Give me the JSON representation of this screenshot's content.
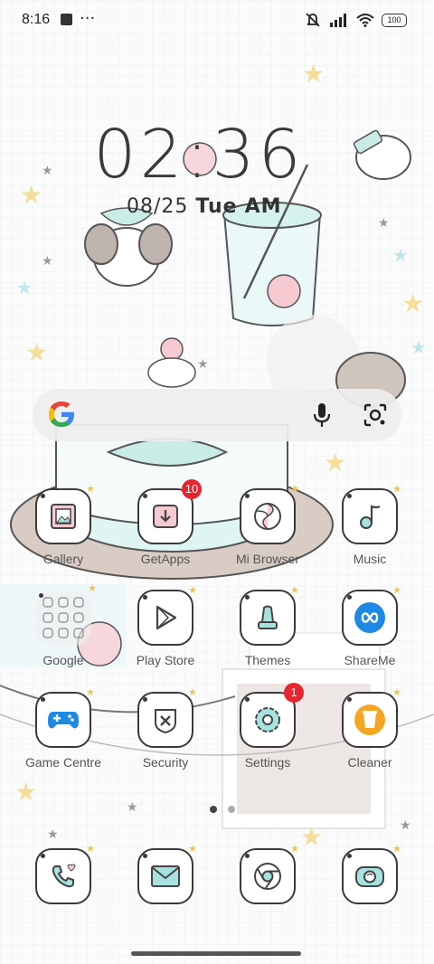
{
  "status_bar": {
    "time": "8:16",
    "more": "···",
    "battery": "100"
  },
  "lockscreen": {
    "clock": "02:36",
    "date": "08/25",
    "day": "Tue",
    "ampm": "AM"
  },
  "search": {
    "logo": "G"
  },
  "apps": [
    {
      "label": "Gallery"
    },
    {
      "label": "GetApps",
      "badge": "10"
    },
    {
      "label": "Mi Browser"
    },
    {
      "label": "Music"
    },
    {
      "label": "Google"
    },
    {
      "label": "Play Store"
    },
    {
      "label": "Themes"
    },
    {
      "label": "ShareMe"
    },
    {
      "label": "Game Centre"
    },
    {
      "label": "Security"
    },
    {
      "label": "Settings",
      "badge": "1"
    },
    {
      "label": "Cleaner"
    }
  ],
  "dock": [
    {
      "icon": "phone-icon"
    },
    {
      "icon": "messages-icon"
    },
    {
      "icon": "chrome-icon"
    },
    {
      "icon": "camera-icon"
    }
  ],
  "colors": {
    "badge": "#e8242e",
    "accent_mint": "#a6e3e0",
    "accent_pink": "#f7c9d1"
  }
}
